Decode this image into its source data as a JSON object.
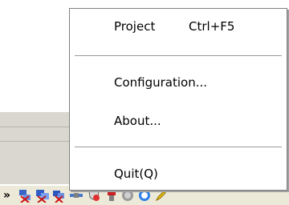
{
  "menu": {
    "items": [
      {
        "label": "Project",
        "shortcut": "Ctrl+F5"
      },
      {
        "label": "Configuration..."
      },
      {
        "label": "About..."
      },
      {
        "label": "Quit(Q)"
      }
    ]
  },
  "taskbar": {
    "chevron": "»",
    "tray_icons": [
      "network-x-icon",
      "network-x-icon",
      "network-x-icon",
      "satellite-icon",
      "shield-icon",
      "usb-icon",
      "sound-icon",
      "globe-icon",
      "pencil-icon"
    ]
  },
  "colors": {
    "menu_bg": "#ffffff",
    "menu_border": "#7f7f7f",
    "taskbar_bg": "#ece9d8",
    "background_strip": "#d9d7cf"
  }
}
